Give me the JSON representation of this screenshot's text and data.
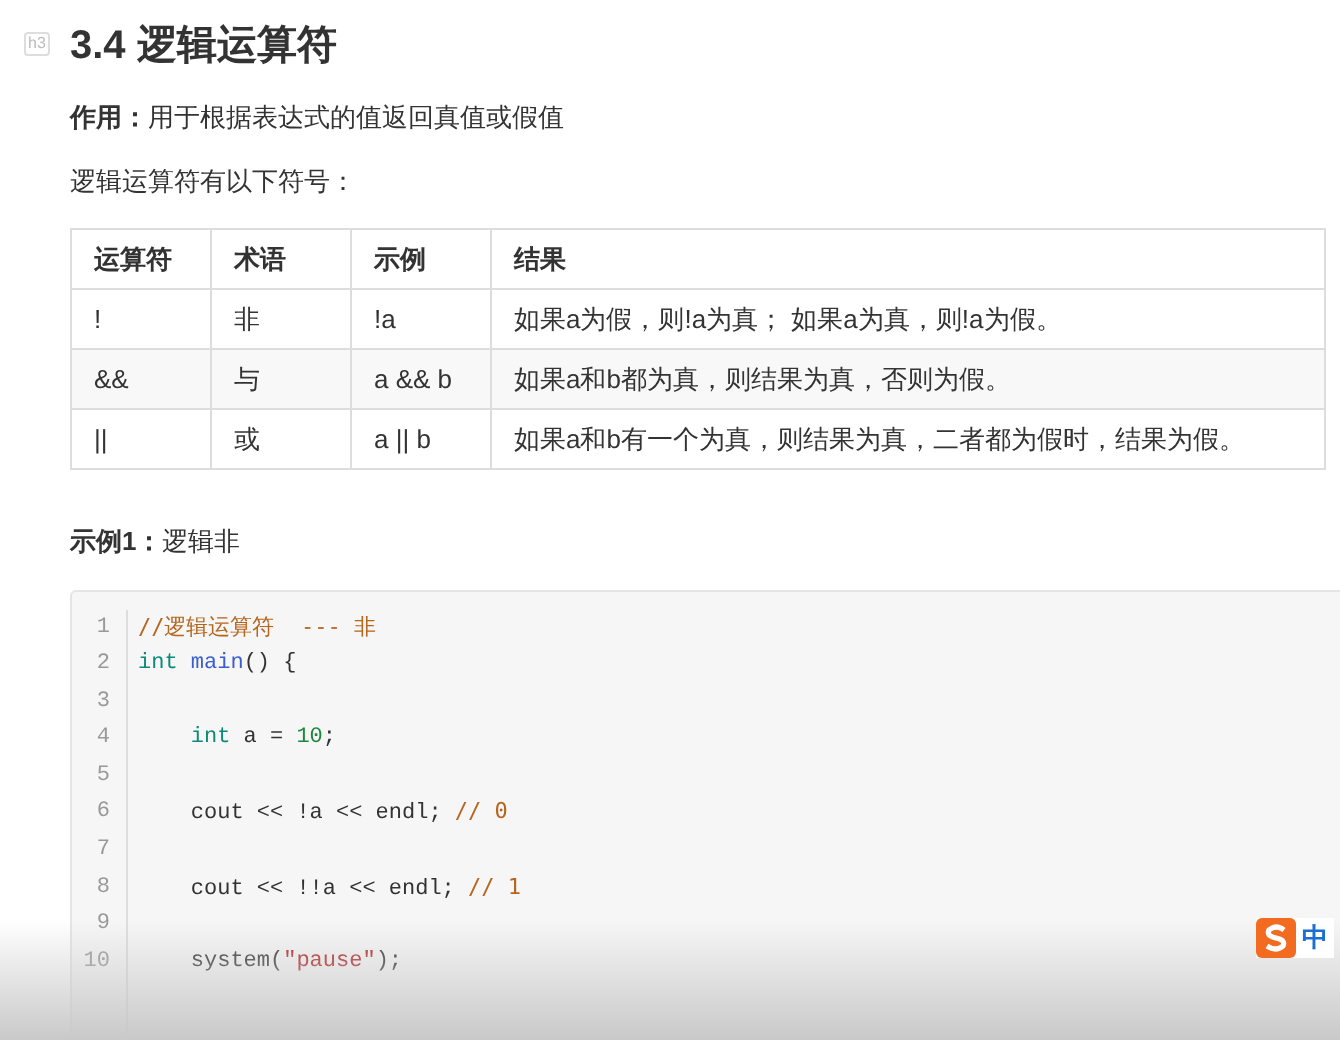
{
  "heading": {
    "tag": "h3",
    "title": "3.4 逻辑运算符"
  },
  "intro": "**作用：**用于根据表达式的值返回真值或假值",
  "lead": "逻辑运算符有以下符号：",
  "table": {
    "columns": [
      "运算符",
      "术语",
      "示例",
      "结果"
    ],
    "rows": [
      [
        "!",
        "非",
        "!a",
        "如果a为假，则!a为真；  如果a为真，则!a为假。"
      ],
      [
        "&&",
        "与",
        "a && b",
        "如果a和b都为真，则结果为真，否则为假。"
      ],
      [
        "||",
        "或",
        "a || b",
        "如果a和b有一个为真，则结果为真，二者都为假时，结果为假。"
      ]
    ]
  },
  "example_title": "**示例1：**逻辑非",
  "code": [
    {
      "number": "1",
      "tokens": [
        {
          "kind": "comment",
          "text": "//逻辑运算符  --- 非"
        }
      ]
    },
    {
      "number": "2",
      "tokens": [
        {
          "kind": "keyword",
          "text": "int "
        },
        {
          "kind": "function",
          "text": "main"
        },
        {
          "kind": "plain",
          "text": "() {"
        }
      ]
    },
    {
      "number": "3"
    },
    {
      "number": "4",
      "indent": true,
      "tokens": [
        {
          "kind": "keyword",
          "text": "int "
        },
        {
          "kind": "plain",
          "text": "a = "
        },
        {
          "kind": "number",
          "text": "10"
        },
        {
          "kind": "plain",
          "text": ";"
        }
      ]
    },
    {
      "number": "5"
    },
    {
      "number": "6",
      "indent": true,
      "tokens": [
        {
          "kind": "plain",
          "text": "cout << !a << endl; "
        },
        {
          "kind": "comment",
          "text": "// 0"
        }
      ]
    },
    {
      "number": "7"
    },
    {
      "number": "8",
      "indent": true,
      "tokens": [
        {
          "kind": "plain",
          "text": "cout << !!a << endl; "
        },
        {
          "kind": "comment",
          "text": "// 1"
        }
      ]
    },
    {
      "number": "9"
    },
    {
      "number": "10",
      "indent": true,
      "tokens": [
        {
          "kind": "plain",
          "text": "system("
        },
        {
          "kind": "string",
          "text": "\"pause\""
        },
        {
          "kind": "plain",
          "text": ");"
        }
      ]
    }
  ],
  "ime": {
    "mode": "中"
  }
}
